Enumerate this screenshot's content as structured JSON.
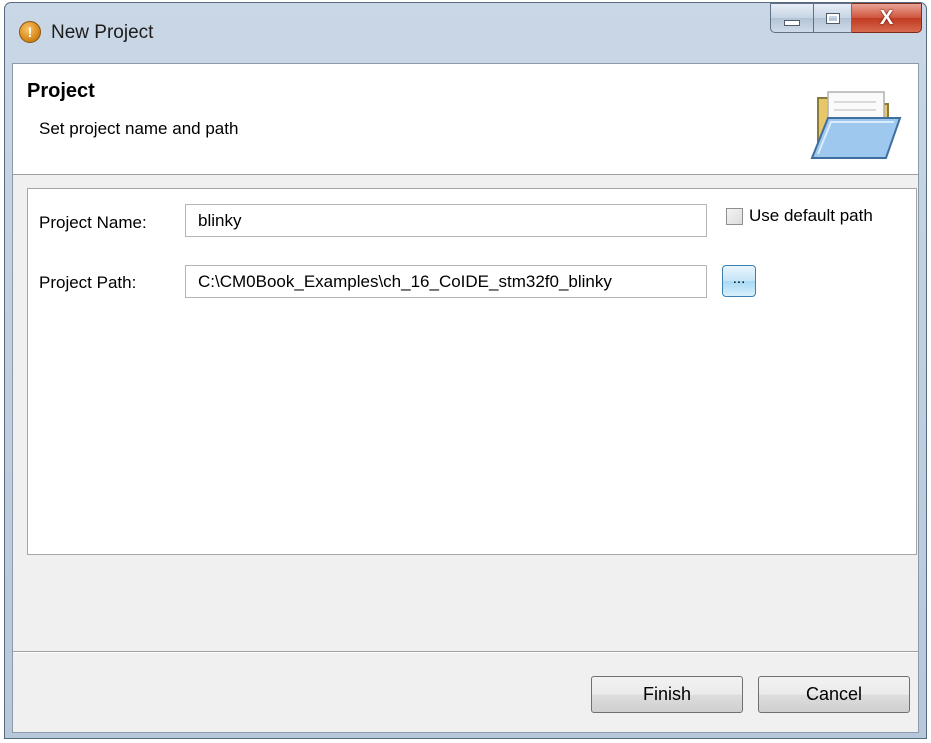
{
  "window": {
    "title": "New Project",
    "app_icon": "info-warning-icon",
    "caption_buttons": [
      "minimize-icon",
      "maximize-icon",
      "close-icon"
    ],
    "close_glyph": "X"
  },
  "banner": {
    "title": "Project",
    "description": "Set project name and path",
    "icon": "open-folder-icon"
  },
  "form": {
    "project_name_label": "Project Name:",
    "project_name_value": "blinky",
    "use_default_path_label": "Use default path",
    "use_default_path_checked": false,
    "project_path_label": "Project Path:",
    "project_path_value": "C:\\CM0Book_Examples\\ch_16_CoIDE_stm32f0_blinky",
    "browse_label": "..."
  },
  "buttons": {
    "finish": "Finish",
    "cancel": "Cancel"
  },
  "colors": {
    "title_bar": "#c9d7e6",
    "close_button": "#c03a20",
    "browse_accent": "#a7d9f5"
  }
}
